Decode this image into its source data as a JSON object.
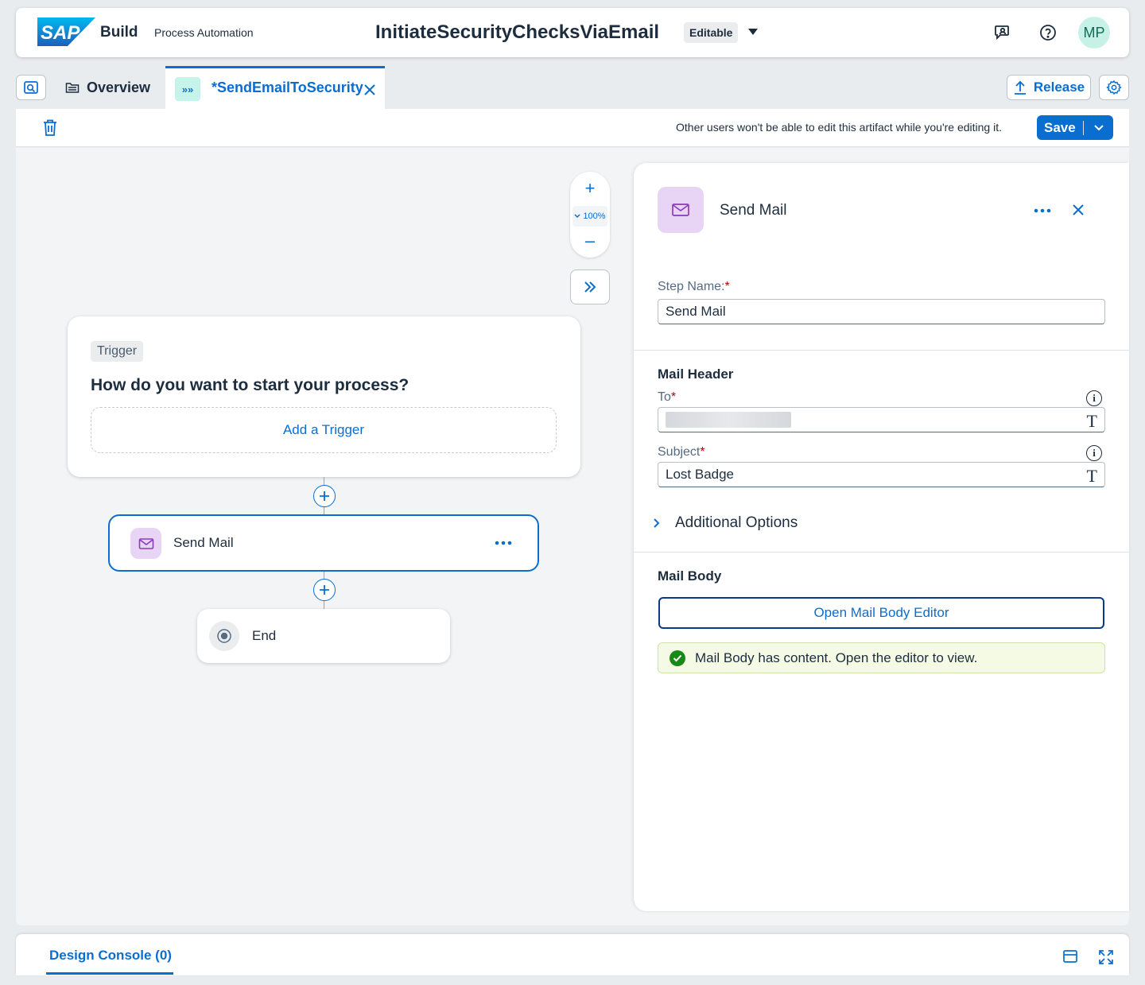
{
  "shell": {
    "logo_text": "SAP",
    "product": "Build",
    "module": "Process Automation",
    "title": "InitiateSecurityChecksViaEmail",
    "status_badge": "Editable",
    "avatar_initials": "MP"
  },
  "tabs": {
    "overview_label": "Overview",
    "active_label": "*SendEmailToSecurity",
    "active_icon": "»»",
    "release_label": "Release"
  },
  "toolbar": {
    "lock_message": "Other users won't be able to edit this artifact while you're editing it.",
    "save_label": "Save"
  },
  "canvas": {
    "zoom_plus": "+",
    "zoom_level": "100%",
    "zoom_minus": "–",
    "trigger": {
      "chip": "Trigger",
      "question": "How do you want to start your process?",
      "add_label": "Add a Trigger"
    },
    "mail_node_label": "Send Mail",
    "end_node_label": "End"
  },
  "panel": {
    "title": "Send Mail",
    "step_name_label": "Step Name:",
    "step_name_value": "Send Mail",
    "mail_header_title": "Mail Header",
    "to_label": "To",
    "subject_label": "Subject",
    "subject_value": "Lost Badge",
    "additional_options": "Additional Options",
    "mail_body_title": "Mail Body",
    "open_editor_label": "Open Mail Body Editor",
    "body_status": "Mail Body has content. Open the editor to view.",
    "required_marker": "*"
  },
  "console": {
    "tab_label": "Design Console (0)"
  },
  "colors": {
    "brand_blue": "#0a6ed1",
    "mail_icon_bg": "#e8d5f5",
    "success": "#188918"
  }
}
